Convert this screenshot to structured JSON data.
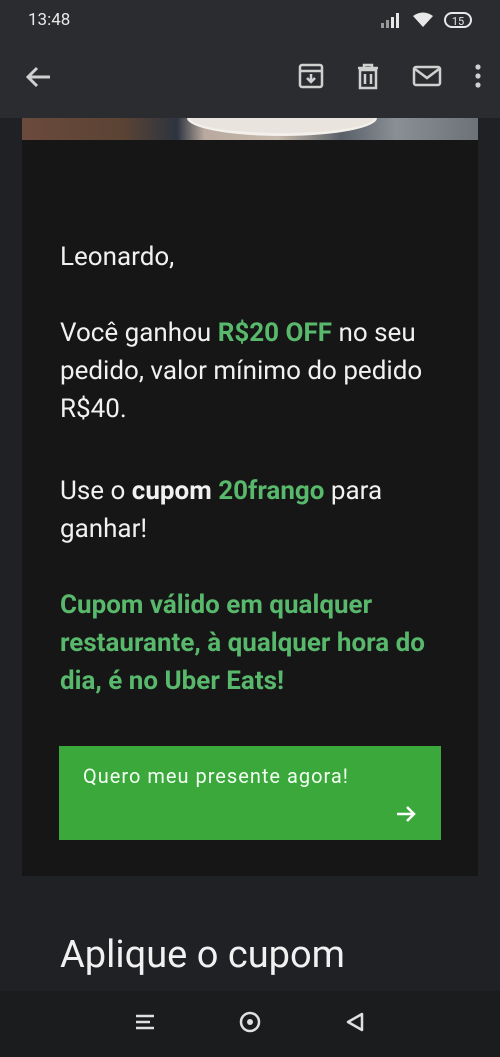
{
  "status_bar": {
    "time": "13:48",
    "battery": "15",
    "icons": [
      "signal-icon",
      "wifi-icon",
      "battery-icon"
    ]
  },
  "toolbar": {
    "back": "arrow-left-icon",
    "actions": [
      "archive-icon",
      "trash-icon",
      "mail-icon",
      "more-vert-icon"
    ]
  },
  "email": {
    "greeting": "Leonardo,",
    "p1_pre": "Você ganhou ",
    "p1_highlight": "R$20 OFF",
    "p1_post": " no seu pedido, valor mínimo do pedido R$40.",
    "p2_pre": "Use o ",
    "p2_bold": "cupom",
    "p2_space": " ",
    "p2_code": "20frango",
    "p2_post": " para ganhar!",
    "p3": "Cupom válido em qualquer restaurante, à qualquer hora do dia, é no Uber Eats!",
    "cta_label": "Quero meu presente agora!",
    "section_title": "Aplique o cupom"
  },
  "colors": {
    "accent_green": "#58b86b",
    "button_green": "#3aa83a",
    "background": "#202124",
    "card": "#161617"
  },
  "nav_bar": [
    "menu-icon",
    "home-circle-icon",
    "back-triangle-icon"
  ]
}
